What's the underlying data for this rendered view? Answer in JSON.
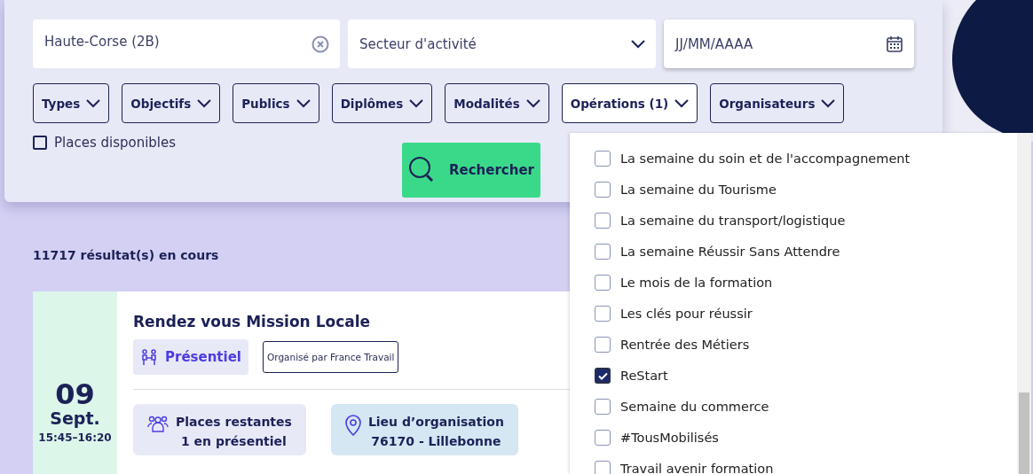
{
  "search": {
    "location": {
      "value": "Haute-Corse (2B)"
    },
    "sector": {
      "placeholder": "Secteur d'activité"
    },
    "date": {
      "placeholder": "JJ/MM/AAAA"
    }
  },
  "filters": [
    {
      "label": "Types",
      "expanded": false
    },
    {
      "label": "Objectifs",
      "expanded": false
    },
    {
      "label": "Publics",
      "expanded": false
    },
    {
      "label": "Diplômes",
      "expanded": false
    },
    {
      "label": "Modalités",
      "expanded": false
    },
    {
      "label": "Opérations (1)",
      "expanded": true
    },
    {
      "label": "Organisateurs",
      "expanded": false
    }
  ],
  "available_places": {
    "label": "Places disponibles",
    "checked": false
  },
  "search_button": "Rechercher",
  "results_count": "11717 résultat(s) en cours",
  "event": {
    "day": "09",
    "month": "Sept.",
    "time": "15:45–16:20",
    "title": "Rendez vous Mission Locale",
    "mode": "Présentiel",
    "organizer": "Organisé par France Travail",
    "places": {
      "label": "Places restantes",
      "value": "1 en présentiel"
    },
    "location": {
      "label": "Lieu d’organisation",
      "value": "76170 - Lillebonne"
    }
  },
  "operations_options": [
    {
      "label": "La semaine du soin et de l'accompagnement",
      "checked": false
    },
    {
      "label": "La semaine du Tourisme",
      "checked": false
    },
    {
      "label": "La semaine du transport/logistique",
      "checked": false
    },
    {
      "label": "La semaine Réussir Sans Attendre",
      "checked": false
    },
    {
      "label": "Le mois de la formation",
      "checked": false
    },
    {
      "label": "Les clés pour réussir",
      "checked": false
    },
    {
      "label": "Rentrée des Métiers",
      "checked": false
    },
    {
      "label": "ReStart",
      "checked": true
    },
    {
      "label": "Semaine du commerce",
      "checked": false
    },
    {
      "label": "#TousMobilisés",
      "checked": false
    },
    {
      "label": "Travail avenir formation",
      "checked": false
    }
  ]
}
